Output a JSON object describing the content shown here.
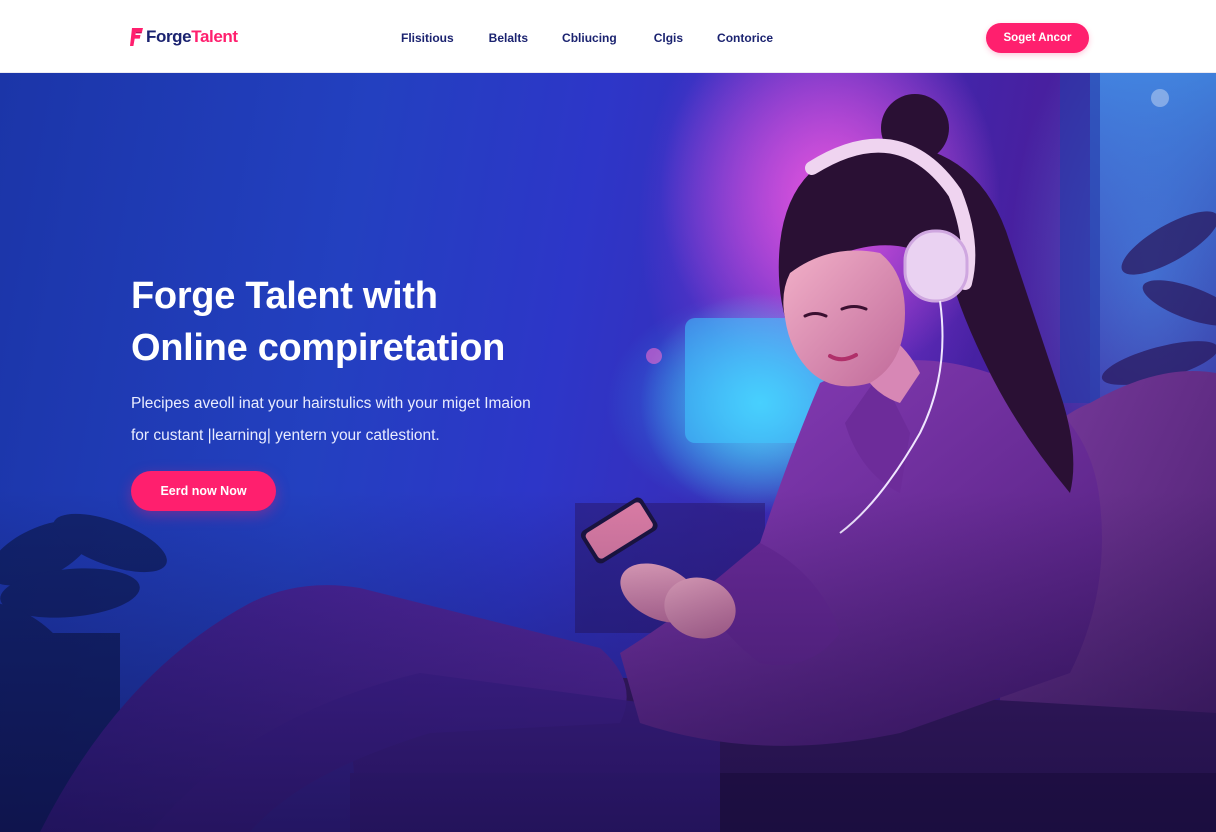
{
  "brand": {
    "name_part1": "Forge",
    "name_part2": "Talent",
    "accent_color": "#ff1f6e",
    "navy_color": "#1b2370"
  },
  "nav": {
    "items": [
      {
        "label": "Flisitious"
      },
      {
        "label": "Belalts"
      },
      {
        "label": "Cbliucing"
      },
      {
        "label": "Clgis"
      },
      {
        "label": "Contorice"
      }
    ],
    "cta_label": "Soget Ancor"
  },
  "hero": {
    "title_line1": "Forge Talent with",
    "title_line2": "Online compiretation",
    "subtitle_line1": "Plecipes aveoll inat your hairstulics with your miget Imaion",
    "subtitle_line2": "for custant |learning| yentern your catlestiont.",
    "cta_label": "Eerd now Now",
    "image_subject": "woman-with-headphones-using-phone-on-couch"
  }
}
